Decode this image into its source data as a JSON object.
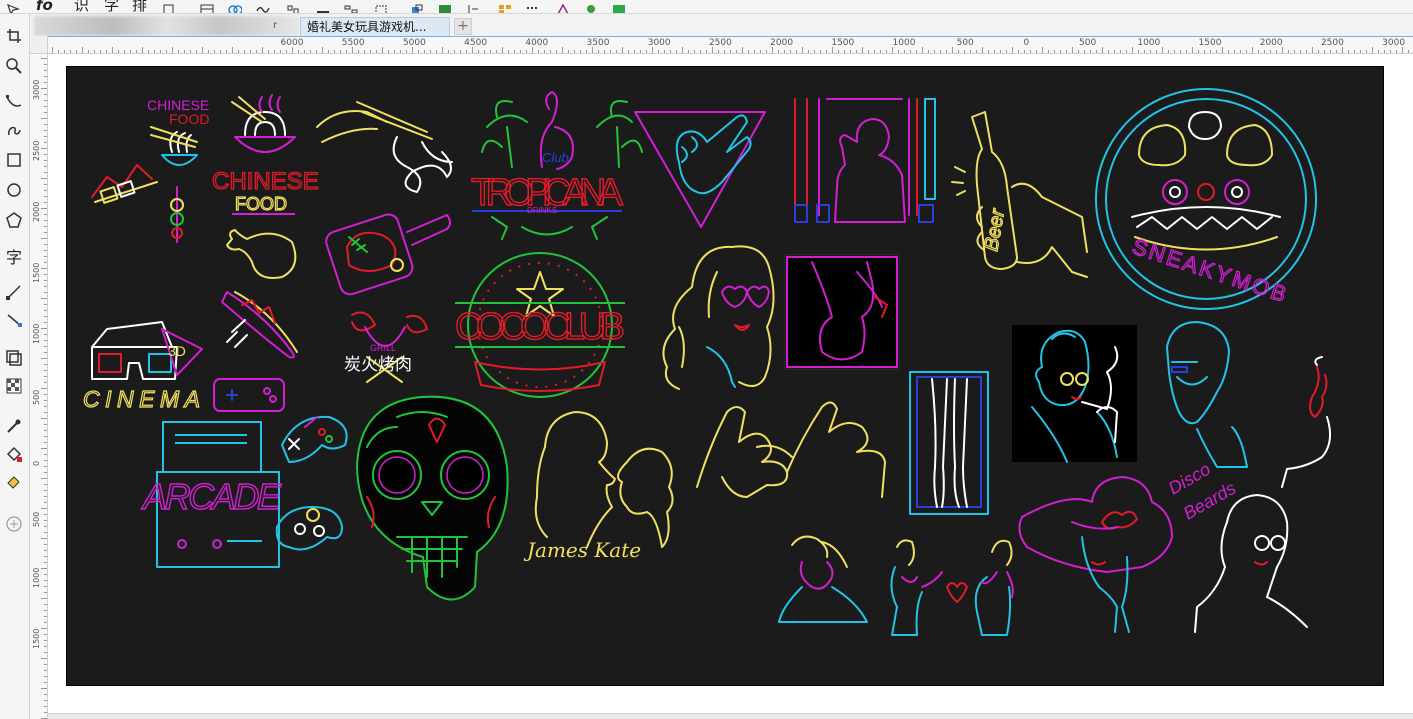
{
  "toolbar": {
    "items": [
      "识",
      "字",
      "排"
    ]
  },
  "tabs": {
    "partial": "r",
    "active": "婚礼美女玩具游戏机...",
    "add": "+"
  },
  "ruler": {
    "h_labels": [
      "6000",
      "5500",
      "5000",
      "4500",
      "4000",
      "3500",
      "3000",
      "2500",
      "2000",
      "1500",
      "1000",
      "500",
      "0",
      "500",
      "1000",
      "1500",
      "2000",
      "2500",
      "3000"
    ],
    "v_labels": [
      "3000",
      "2500",
      "2000",
      "1500",
      "1000",
      "500",
      "0",
      "500",
      "1000",
      "1500"
    ]
  },
  "artwork": {
    "chinese_food_small_1": "CHINESE",
    "chinese_food_small_2": "FOOD",
    "chinese_food_big_1": "CHINESE",
    "chinese_food_big_2": "FOOD",
    "club": "Club",
    "tropicana": "TROPICANA",
    "drinks": "DRINKS",
    "cococlub": "COCOCLUB",
    "grill": "GRILL",
    "bbq_cn": "炭火烤肉",
    "cinema": "CINEMA",
    "three_d": "3D",
    "arcade": "ARCADE",
    "james_kate": "James Kate",
    "beer": "Beer",
    "sneakymob": "SNEAKYMOB",
    "disco_beards_1": "Disco",
    "disco_beards_2": "Beards"
  },
  "colors": {
    "canvas": "#1b1b1b",
    "cyan": "#22c3e6",
    "magenta": "#d21fd2",
    "red": "#e21b2a",
    "yellow": "#f0e060",
    "green": "#22c33a",
    "white": "#ffffff",
    "blue": "#2a3fd9",
    "ruler_accent": "#6fb4df"
  }
}
